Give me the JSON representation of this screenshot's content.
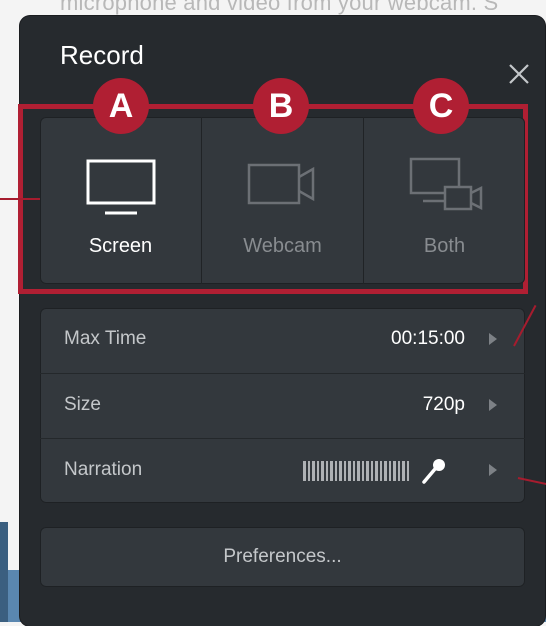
{
  "background": {
    "caption": "microphone and video from your webcam. S"
  },
  "dialog": {
    "title": "Record",
    "close_icon": "close-icon"
  },
  "modes": {
    "badges": [
      "A",
      "B",
      "C"
    ],
    "items": [
      {
        "label": "Screen",
        "icon": "monitor-icon",
        "selected": true
      },
      {
        "label": "Webcam",
        "icon": "webcam-icon",
        "selected": false
      },
      {
        "label": "Both",
        "icon": "screen-and-webcam-icon",
        "selected": false
      }
    ]
  },
  "settings": {
    "max_time": {
      "label": "Max Time",
      "value": "00:15:00"
    },
    "size": {
      "label": "Size",
      "value": "720p"
    },
    "narration": {
      "label": "Narration",
      "icon": "microphone-icon"
    }
  },
  "preferences": {
    "label": "Preferences..."
  },
  "colors": {
    "annotation": "#b01f33",
    "panel": "#262a2e",
    "control": "#33383d"
  }
}
